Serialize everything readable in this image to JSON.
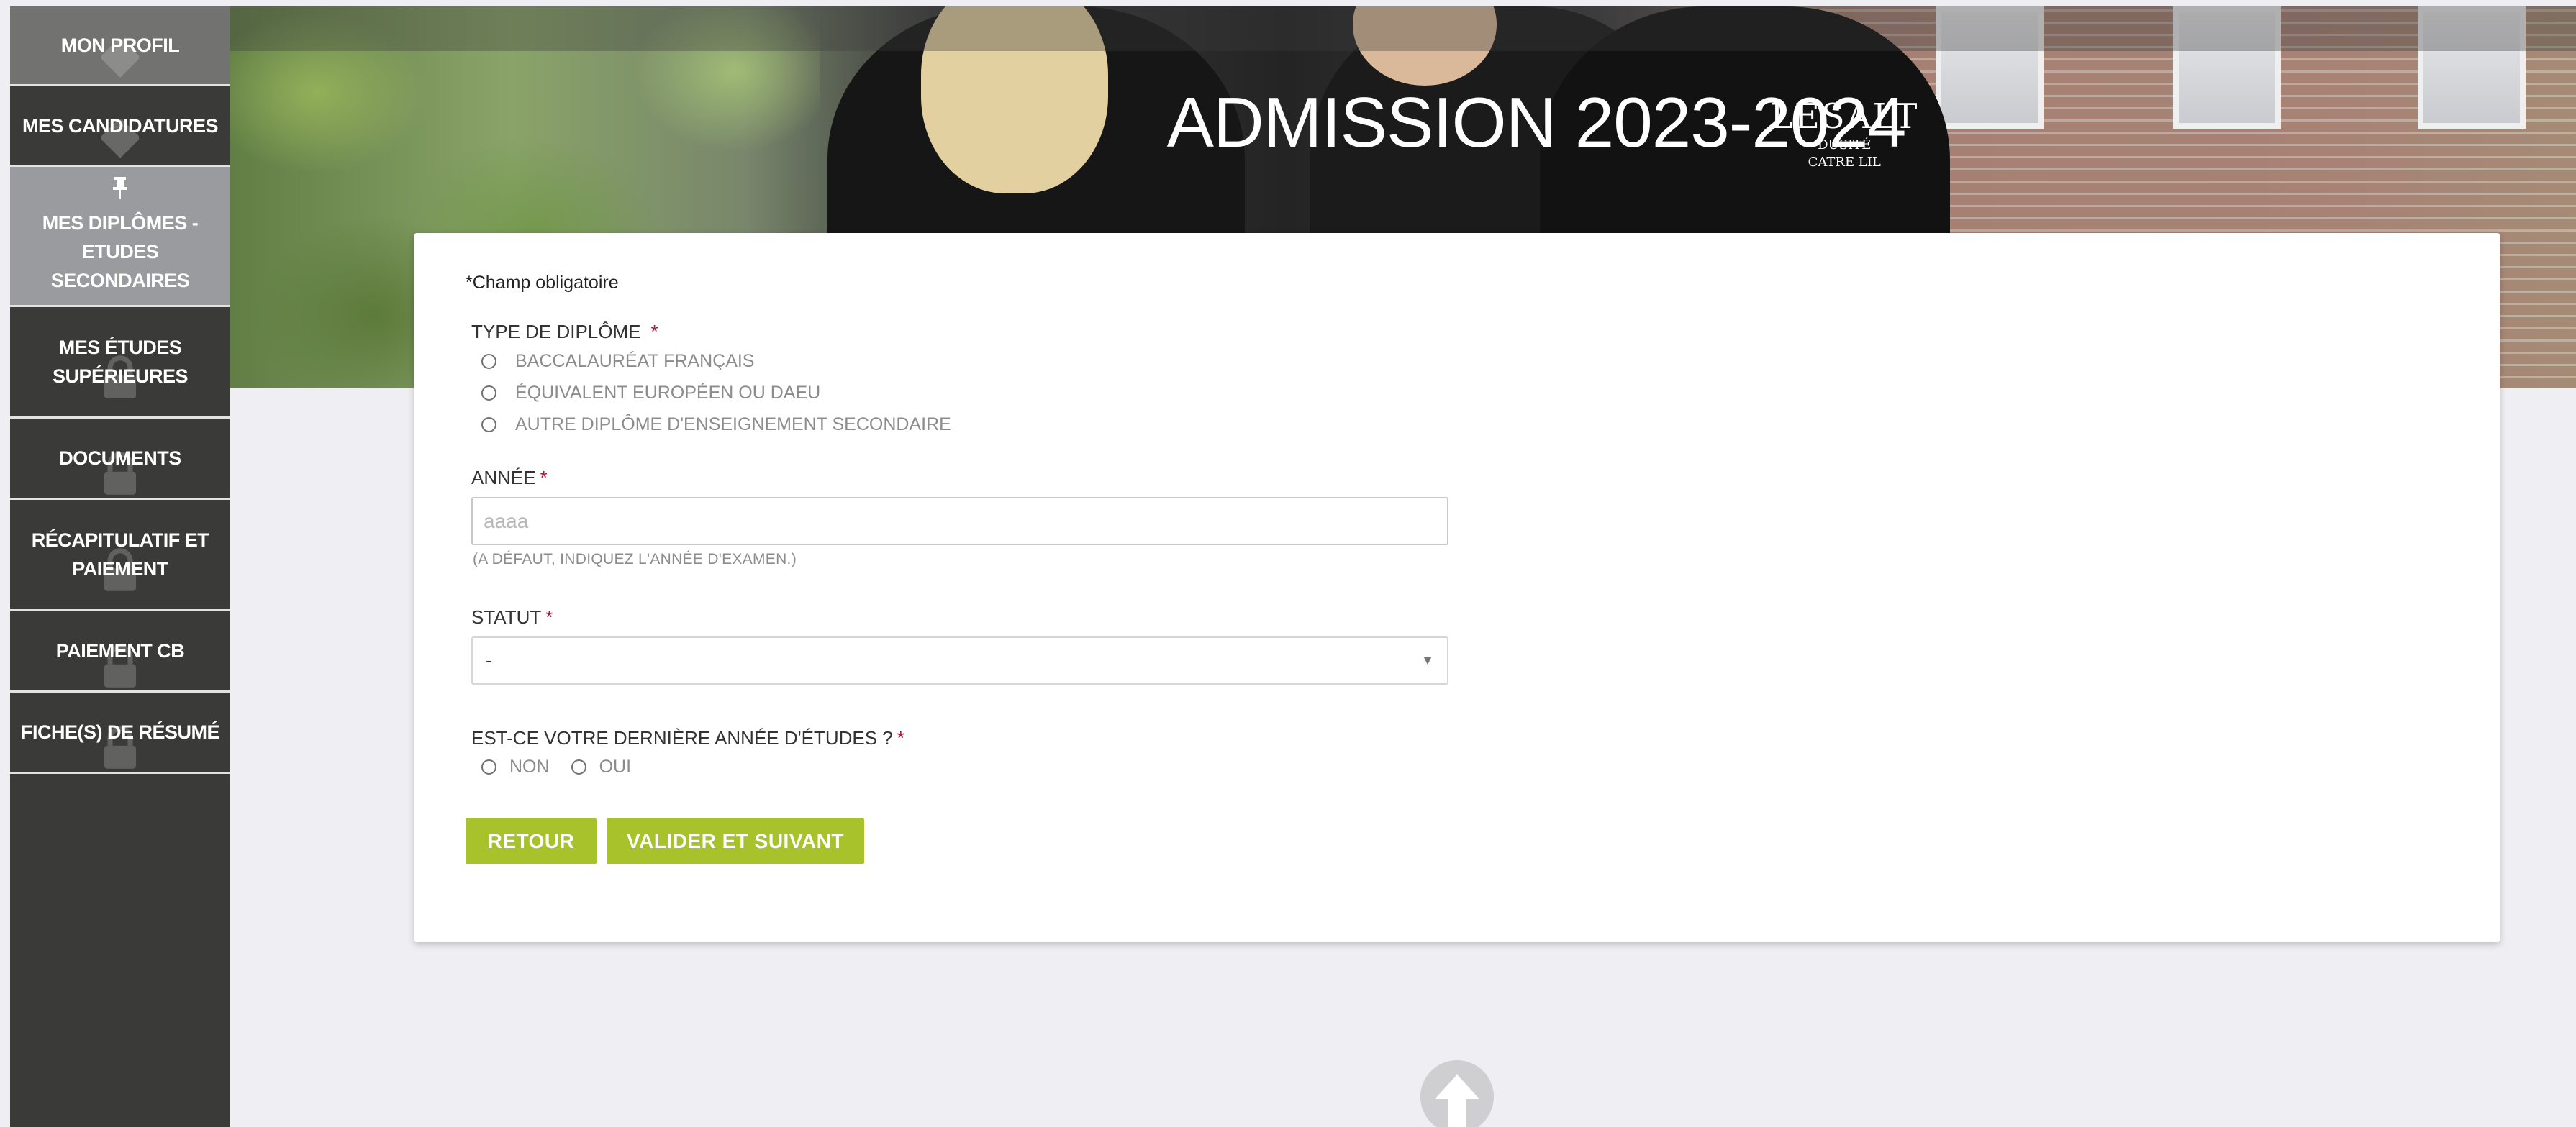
{
  "sidebar": {
    "items": [
      {
        "label": "MON PROFIL",
        "icon": "chevron-down-icon",
        "state": "normal"
      },
      {
        "label": "MES CANDIDATURES",
        "icon": "chevron-down-icon",
        "state": "normal"
      },
      {
        "label": "MES DIPLÔMES - ETUDES SECONDAIRES",
        "icon": "pin-icon",
        "state": "active"
      },
      {
        "label": "MES ÉTUDES SUPÉRIEURES",
        "icon": "lock-icon",
        "state": "locked"
      },
      {
        "label": "DOCUMENTS",
        "icon": "lock-icon",
        "state": "locked"
      },
      {
        "label": "RÉCAPITULATIF ET PAIEMENT",
        "icon": "lock-icon",
        "state": "locked"
      },
      {
        "label": "PAIEMENT CB",
        "icon": "lock-icon",
        "state": "locked"
      },
      {
        "label": "FICHE(S) DE RÉSUMÉ",
        "icon": "lock-icon",
        "state": "locked"
      }
    ]
  },
  "banner": {
    "title": "ADMISSION 2023-2024",
    "crest_big": "LESALT",
    "crest_line1": "DUSITÉ",
    "crest_line2": "CATRE LIL"
  },
  "form": {
    "required_note": "*Champ obligatoire",
    "diploma_type": {
      "label": "TYPE DE DIPLÔME",
      "required_mark": "*",
      "options": [
        "BACCALAURÉAT FRANÇAIS",
        "ÉQUIVALENT EUROPÉEN OU DAEU",
        "AUTRE DIPLÔME D'ENSEIGNEMENT SECONDAIRE"
      ]
    },
    "year": {
      "label": "ANNÉE",
      "required_mark": "*",
      "placeholder": "aaaa",
      "value": "",
      "hint": "(A DÉFAUT, INDIQUEZ L'ANNÉE D'EXAMEN.)"
    },
    "status": {
      "label": "STATUT",
      "required_mark": "*",
      "selected": "-"
    },
    "last_year": {
      "label": "EST-CE VOTRE DERNIÈRE ANNÉE D'ÉTUDES ?",
      "required_mark": "*",
      "options": [
        "NON",
        "OUI"
      ]
    },
    "buttons": {
      "back": "RETOUR",
      "next": "VALIDER ET SUIVANT"
    }
  },
  "colors": {
    "sidebar_bg": "#3a3a38",
    "sidebar_active": "#9a9b9e",
    "accent_green": "#a8c22b",
    "required_red": "#b0122f",
    "page_bg": "#efeff3"
  }
}
